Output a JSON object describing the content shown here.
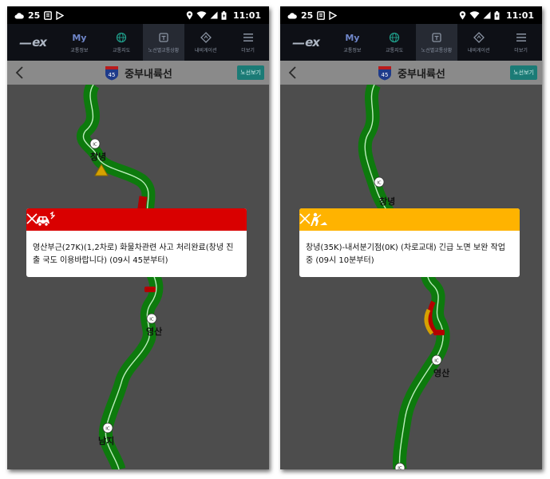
{
  "screens": [
    {
      "status": {
        "temperature": "25",
        "time": "11:01"
      },
      "nav": {
        "logo": "ex",
        "tabs": [
          {
            "top": "My",
            "label": "교통정보"
          },
          {
            "label": "교통지도"
          },
          {
            "label": "노선별교통상황"
          },
          {
            "label": "내비게이션"
          },
          {
            "label": "더보기"
          }
        ]
      },
      "header": {
        "route_number": "45",
        "title": "중부내륙선",
        "route_button": "노선보기"
      },
      "map_labels": [
        "창녕",
        "영산",
        "남지"
      ],
      "popup": {
        "type": "accident",
        "color": "#d90000",
        "message": "영산부근(27K)(1,2차로) 화물차관련 사고 처리완료(창녕 진출 국도 이용바랍니다) (09시 45분부터)"
      }
    },
    {
      "status": {
        "temperature": "25",
        "time": "11:01"
      },
      "nav": {
        "logo": "ex",
        "tabs": [
          {
            "top": "My",
            "label": "교통정보"
          },
          {
            "label": "교통지도"
          },
          {
            "label": "노선별교통상황"
          },
          {
            "label": "내비게이션"
          },
          {
            "label": "더보기"
          }
        ]
      },
      "header": {
        "route_number": "45",
        "title": "중부내륙선",
        "route_button": "노선보기"
      },
      "map_labels": [
        "창녕",
        "영산"
      ],
      "popup": {
        "type": "roadwork",
        "color": "#ffb300",
        "message": "창녕(35K)-내서분기점(0K) (차로교대) 긴급 노면 보완 작업 중 (09시 10분부터)"
      }
    }
  ]
}
